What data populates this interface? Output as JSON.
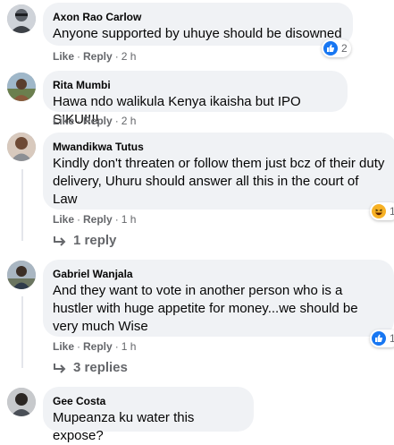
{
  "comments": [
    {
      "author": "Axon Rao Carlow",
      "text": "Anyone supported by uhuye should be disowned",
      "like": "Like",
      "reply": "Reply",
      "time": "2 h",
      "reaction_count": "2",
      "reaction_icon": "like-icon"
    },
    {
      "author": "Rita Mumbi",
      "text": "Hawa ndo walikula Kenya ikaisha but IPO SIKU!!!!",
      "like": "Like",
      "reply": "Reply",
      "time": "2 h"
    },
    {
      "author": "Mwandikwa Tutus",
      "text": "Kindly don't threaten or follow them just bcz of their duty delivery, Uhuru should answer all this in the court of Law",
      "like": "Like",
      "reply": "Reply",
      "time": "1 h",
      "reaction_count": "1",
      "reaction_icon": "haha-icon",
      "replies_label": "1 reply"
    },
    {
      "author": "Gabriel Wanjala",
      "text": "And they want to vote in another person who is a hustler with huge appetite for money...we should be very much Wise",
      "like": "Like",
      "reply": "Reply",
      "time": "1 h",
      "reaction_count": "1",
      "reaction_icon": "like-icon",
      "replies_label": "3 replies"
    },
    {
      "author": "Gee Costa",
      "text": "Mupeanza ku water this expose?"
    }
  ],
  "colors": {
    "bubble": "#f0f2f5",
    "meta": "#65676b",
    "like_blue": "#1877f2",
    "haha_yellow": "#f7b125"
  }
}
